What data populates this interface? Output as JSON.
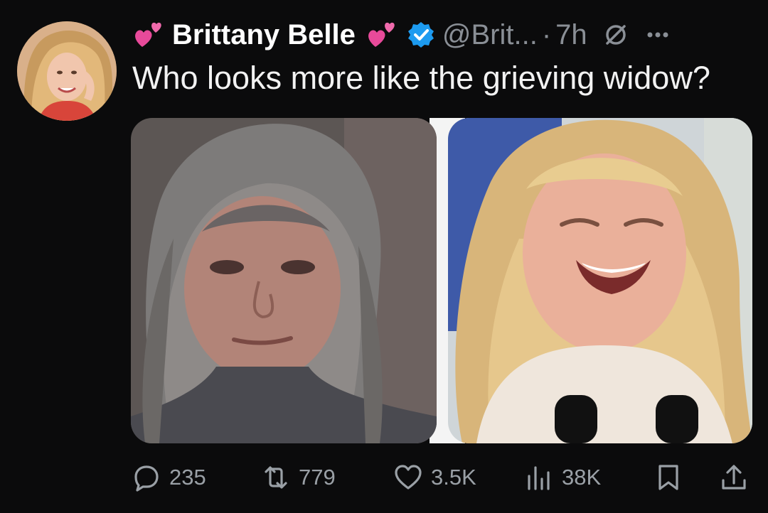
{
  "author": {
    "name_prefix_emoji": "💕",
    "display_name": "Brittany Belle",
    "name_suffix_emoji": "💕",
    "verified": true,
    "handle": "@Brit...",
    "separator": "·",
    "time": "7h"
  },
  "tweet": {
    "text": "Who looks more like the grieving widow?"
  },
  "actions": {
    "replies": "235",
    "reposts": "779",
    "likes": "3.5K",
    "views": "38K"
  },
  "icons": {
    "reply": "reply-icon",
    "repost": "repost-icon",
    "like": "heart-icon",
    "views": "views-icon",
    "bookmark": "bookmark-icon",
    "share": "share-icon",
    "mute": "mute-icon",
    "more": "more-icon",
    "verified": "verified-badge-icon"
  },
  "colors": {
    "background": "#0b0b0c",
    "text": "#ffffff",
    "muted": "#8a8f96",
    "verified": "#1d9bf0",
    "emoji_heart": "#e0418f"
  }
}
